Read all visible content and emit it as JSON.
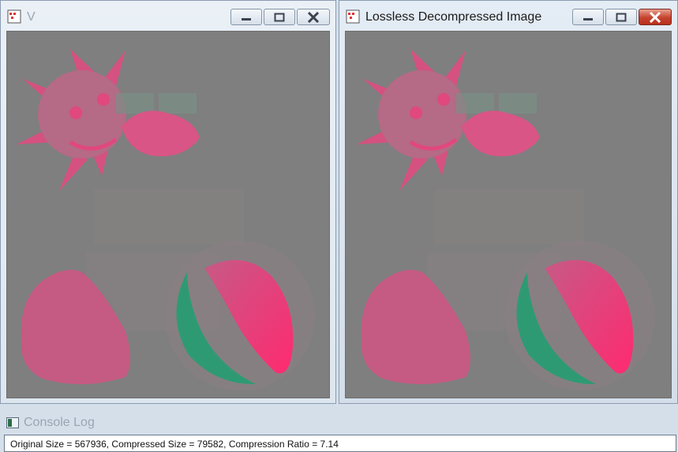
{
  "windows": [
    {
      "title": "V",
      "state": "inactive",
      "controls": {
        "minimize": "minimize-icon",
        "maximize": "maximize-icon",
        "close": "close-icon"
      }
    },
    {
      "title": "Lossless Decompressed Image",
      "state": "active",
      "controls": {
        "minimize": "minimize-icon",
        "maximize": "maximize-icon",
        "close": "close-icon"
      }
    }
  ],
  "console": {
    "title": "Console Log",
    "message": "Original Size = 567936, Compressed Size = 79582, Compression Ratio = 7.14"
  },
  "colors": {
    "canvas": "#7f7f7f",
    "pink": "#e0487e",
    "hot_pink": "#ff2a70",
    "green": "#2e9a74"
  }
}
